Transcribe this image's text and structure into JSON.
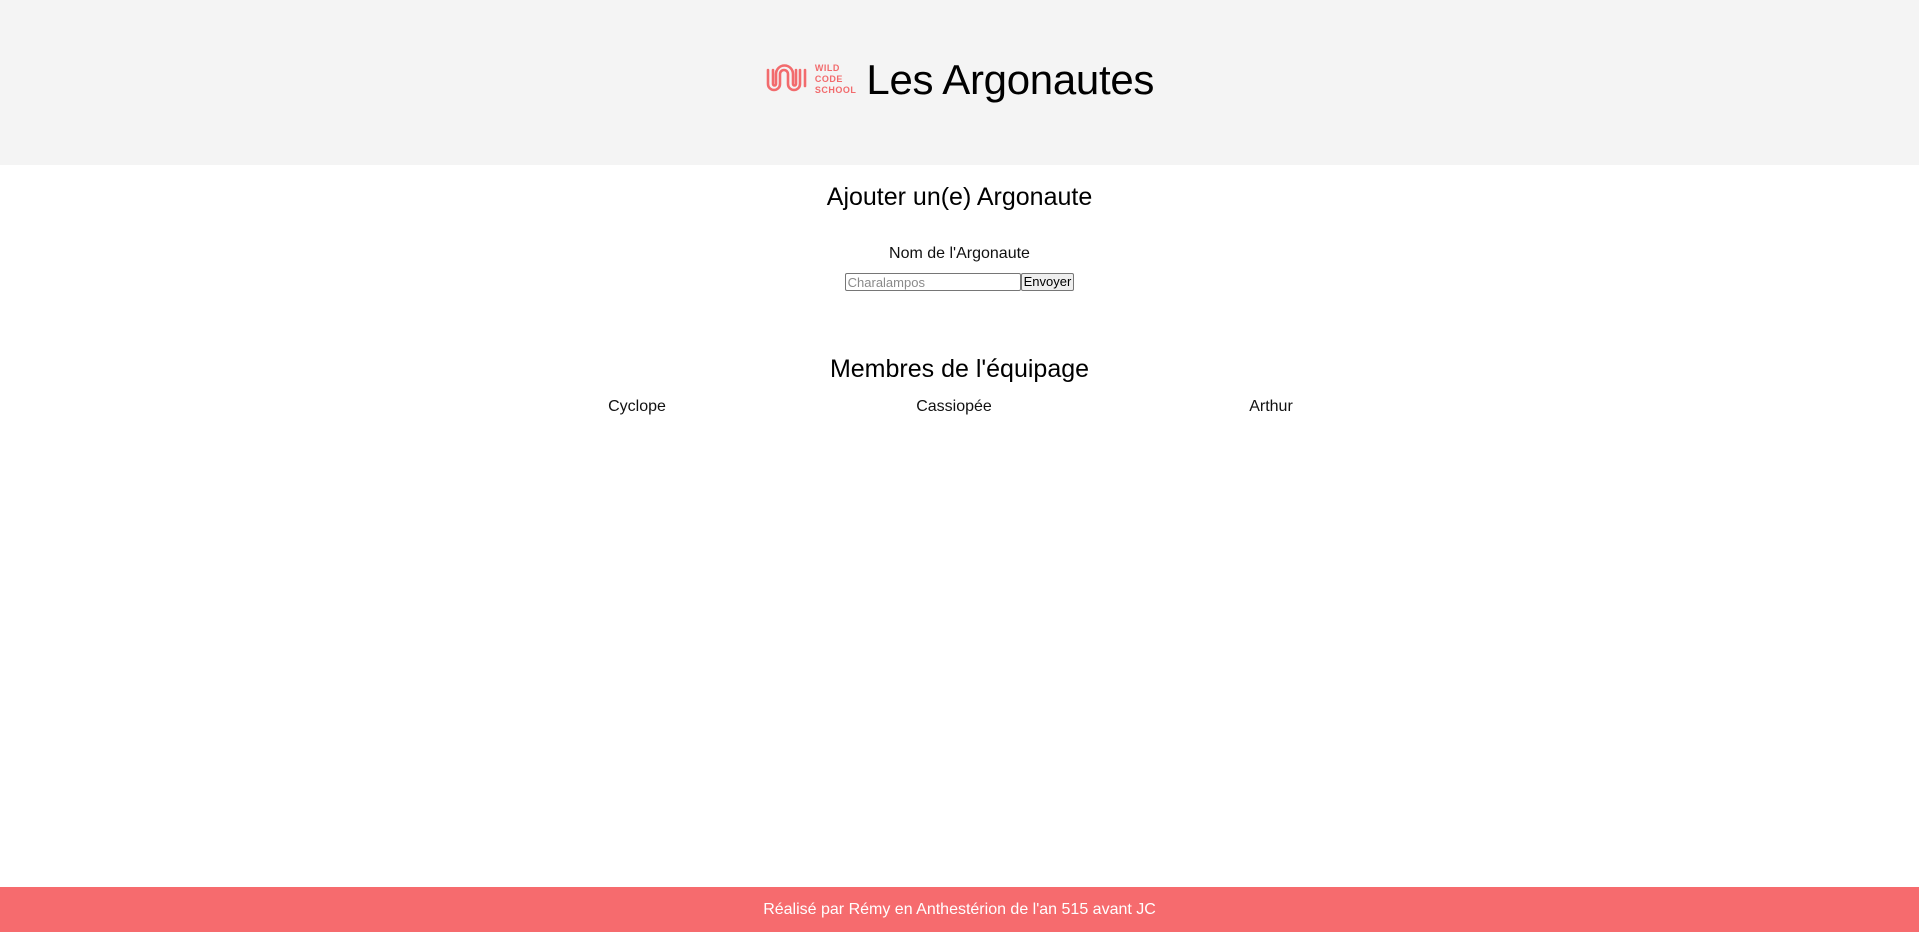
{
  "header": {
    "logo_lines": [
      "WILD",
      "CODE",
      "SCHOOL"
    ],
    "title": "Les Argonautes",
    "brand_color": "#f26b6d",
    "background": "#f4f4f4"
  },
  "form": {
    "title": "Ajouter un(e) Argonaute",
    "label": "Nom de l'Argonaute",
    "input_placeholder": "Charalampos",
    "input_value": "",
    "submit_label": "Envoyer"
  },
  "crew": {
    "title": "Membres de l'équipage",
    "members": [
      "Cyclope",
      "Cassiopée",
      "Arthur"
    ]
  },
  "footer": {
    "text": "Réalisé par Rémy en Anthestérion de l'an 515 avant JC",
    "background": "#f66b6e"
  }
}
